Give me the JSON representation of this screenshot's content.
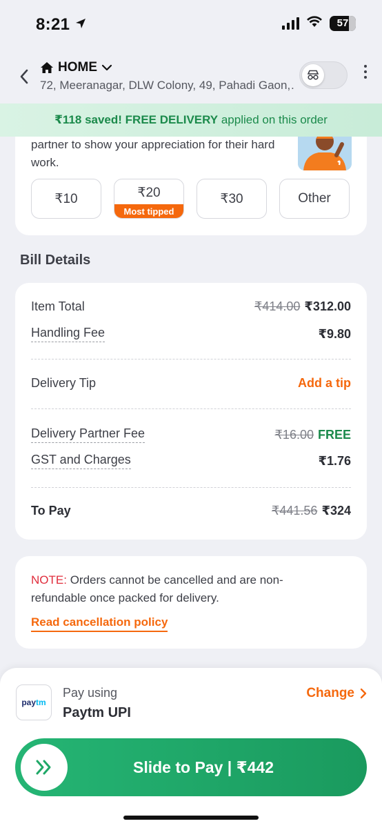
{
  "status_bar": {
    "time": "8:21",
    "battery": "57"
  },
  "header": {
    "address_title": "HOME",
    "address_line": "72, Meeranagar, DLW Colony, 49, Pahadi Gaon,…"
  },
  "savings_banner": {
    "amount_text": "₹118 saved! FREE DELIVERY",
    "suffix_text": "applied on this order"
  },
  "tip_section": {
    "description": "partner to show your appreciation for their hard work.",
    "options": [
      {
        "label": "₹10"
      },
      {
        "label": "₹20",
        "badge": "Most tipped"
      },
      {
        "label": "₹30"
      },
      {
        "label": "Other"
      }
    ]
  },
  "bill_details": {
    "title": "Bill Details",
    "item_total": {
      "label": "Item Total",
      "original": "₹414.00",
      "value": "₹312.00"
    },
    "handling_fee": {
      "label": "Handling Fee",
      "value": "₹9.80"
    },
    "delivery_tip": {
      "label": "Delivery Tip",
      "action": "Add a tip"
    },
    "delivery_partner_fee": {
      "label": "Delivery Partner Fee",
      "original": "₹16.00",
      "value": "FREE"
    },
    "gst": {
      "label": "GST and Charges",
      "value": "₹1.76"
    },
    "to_pay": {
      "label": "To Pay",
      "original": "₹441.56",
      "value": "₹324"
    }
  },
  "note": {
    "label": "NOTE:",
    "text": "Orders cannot be cancelled and are non-refundable once packed for delivery.",
    "link": "Read cancellation policy"
  },
  "payment": {
    "logo_pay": "pay",
    "logo_tm": "tm",
    "pay_using": "Pay using",
    "method": "Paytm UPI",
    "change": "Change",
    "slide_label": "Slide to Pay | ₹442"
  },
  "colors": {
    "accent_orange": "#f5680d",
    "success_green": "#1b8a4b",
    "note_red": "#e02d3c",
    "pay_button_green": "#1fa867"
  }
}
